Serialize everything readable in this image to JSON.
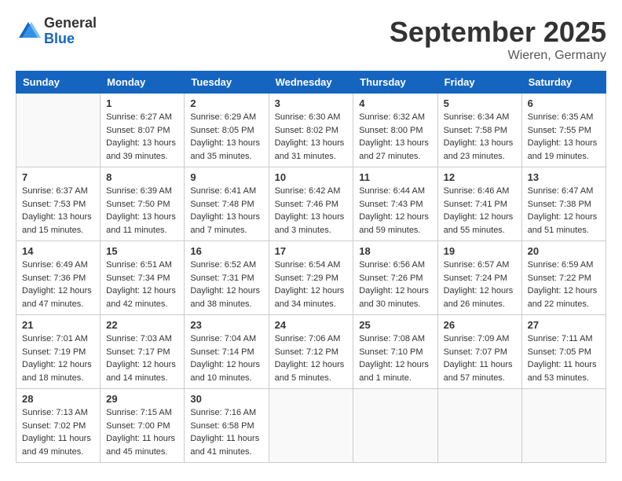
{
  "header": {
    "logo_general": "General",
    "logo_blue": "Blue",
    "month_title": "September 2025",
    "location": "Wieren, Germany"
  },
  "days_of_week": [
    "Sunday",
    "Monday",
    "Tuesday",
    "Wednesday",
    "Thursday",
    "Friday",
    "Saturday"
  ],
  "weeks": [
    [
      {
        "day": "",
        "empty": true
      },
      {
        "day": "1",
        "sunrise": "6:27 AM",
        "sunset": "8:07 PM",
        "daylight": "13 hours and 39 minutes."
      },
      {
        "day": "2",
        "sunrise": "6:29 AM",
        "sunset": "8:05 PM",
        "daylight": "13 hours and 35 minutes."
      },
      {
        "day": "3",
        "sunrise": "6:30 AM",
        "sunset": "8:02 PM",
        "daylight": "13 hours and 31 minutes."
      },
      {
        "day": "4",
        "sunrise": "6:32 AM",
        "sunset": "8:00 PM",
        "daylight": "13 hours and 27 minutes."
      },
      {
        "day": "5",
        "sunrise": "6:34 AM",
        "sunset": "7:58 PM",
        "daylight": "13 hours and 23 minutes."
      },
      {
        "day": "6",
        "sunrise": "6:35 AM",
        "sunset": "7:55 PM",
        "daylight": "13 hours and 19 minutes."
      }
    ],
    [
      {
        "day": "7",
        "sunrise": "6:37 AM",
        "sunset": "7:53 PM",
        "daylight": "13 hours and 15 minutes."
      },
      {
        "day": "8",
        "sunrise": "6:39 AM",
        "sunset": "7:50 PM",
        "daylight": "13 hours and 11 minutes."
      },
      {
        "day": "9",
        "sunrise": "6:41 AM",
        "sunset": "7:48 PM",
        "daylight": "13 hours and 7 minutes."
      },
      {
        "day": "10",
        "sunrise": "6:42 AM",
        "sunset": "7:46 PM",
        "daylight": "13 hours and 3 minutes."
      },
      {
        "day": "11",
        "sunrise": "6:44 AM",
        "sunset": "7:43 PM",
        "daylight": "12 hours and 59 minutes."
      },
      {
        "day": "12",
        "sunrise": "6:46 AM",
        "sunset": "7:41 PM",
        "daylight": "12 hours and 55 minutes."
      },
      {
        "day": "13",
        "sunrise": "6:47 AM",
        "sunset": "7:38 PM",
        "daylight": "12 hours and 51 minutes."
      }
    ],
    [
      {
        "day": "14",
        "sunrise": "6:49 AM",
        "sunset": "7:36 PM",
        "daylight": "12 hours and 47 minutes."
      },
      {
        "day": "15",
        "sunrise": "6:51 AM",
        "sunset": "7:34 PM",
        "daylight": "12 hours and 42 minutes."
      },
      {
        "day": "16",
        "sunrise": "6:52 AM",
        "sunset": "7:31 PM",
        "daylight": "12 hours and 38 minutes."
      },
      {
        "day": "17",
        "sunrise": "6:54 AM",
        "sunset": "7:29 PM",
        "daylight": "12 hours and 34 minutes."
      },
      {
        "day": "18",
        "sunrise": "6:56 AM",
        "sunset": "7:26 PM",
        "daylight": "12 hours and 30 minutes."
      },
      {
        "day": "19",
        "sunrise": "6:57 AM",
        "sunset": "7:24 PM",
        "daylight": "12 hours and 26 minutes."
      },
      {
        "day": "20",
        "sunrise": "6:59 AM",
        "sunset": "7:22 PM",
        "daylight": "12 hours and 22 minutes."
      }
    ],
    [
      {
        "day": "21",
        "sunrise": "7:01 AM",
        "sunset": "7:19 PM",
        "daylight": "12 hours and 18 minutes."
      },
      {
        "day": "22",
        "sunrise": "7:03 AM",
        "sunset": "7:17 PM",
        "daylight": "12 hours and 14 minutes."
      },
      {
        "day": "23",
        "sunrise": "7:04 AM",
        "sunset": "7:14 PM",
        "daylight": "12 hours and 10 minutes."
      },
      {
        "day": "24",
        "sunrise": "7:06 AM",
        "sunset": "7:12 PM",
        "daylight": "12 hours and 5 minutes."
      },
      {
        "day": "25",
        "sunrise": "7:08 AM",
        "sunset": "7:10 PM",
        "daylight": "12 hours and 1 minute."
      },
      {
        "day": "26",
        "sunrise": "7:09 AM",
        "sunset": "7:07 PM",
        "daylight": "11 hours and 57 minutes."
      },
      {
        "day": "27",
        "sunrise": "7:11 AM",
        "sunset": "7:05 PM",
        "daylight": "11 hours and 53 minutes."
      }
    ],
    [
      {
        "day": "28",
        "sunrise": "7:13 AM",
        "sunset": "7:02 PM",
        "daylight": "11 hours and 49 minutes."
      },
      {
        "day": "29",
        "sunrise": "7:15 AM",
        "sunset": "7:00 PM",
        "daylight": "11 hours and 45 minutes."
      },
      {
        "day": "30",
        "sunrise": "7:16 AM",
        "sunset": "6:58 PM",
        "daylight": "11 hours and 41 minutes."
      },
      {
        "day": "",
        "empty": true
      },
      {
        "day": "",
        "empty": true
      },
      {
        "day": "",
        "empty": true
      },
      {
        "day": "",
        "empty": true
      }
    ]
  ]
}
